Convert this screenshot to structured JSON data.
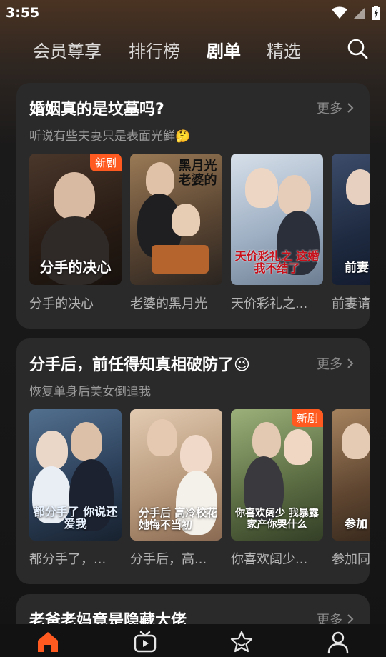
{
  "status_bar": {
    "time": "3:55"
  },
  "top_nav": {
    "tabs": [
      {
        "label": "会员尊享",
        "active": false
      },
      {
        "label": "排行榜",
        "active": false
      },
      {
        "label": "剧单",
        "active": true
      },
      {
        "label": "精选",
        "active": false
      }
    ],
    "search_icon": "search-icon"
  },
  "playlists": [
    {
      "title": "婚姻真的是坟墓吗?",
      "subtitle": "听说有些夫妻只是表面光鲜🤔",
      "more_label": "更多",
      "items": [
        {
          "name": "分手的决心",
          "poster_text": "分手的决心",
          "badge": "新剧",
          "colors": [
            "#3b2b22",
            "#1d1612"
          ]
        },
        {
          "name": "老婆的黑月光",
          "poster_text": "黑月光 老婆的",
          "badge": "",
          "colors": [
            "#7a5a3a",
            "#2b2620"
          ]
        },
        {
          "name": "天价彩礼之...",
          "poster_text": "天价彩礼之 这婚我不结了",
          "badge": "",
          "colors": [
            "#b9c7d6",
            "#6d7f93"
          ]
        },
        {
          "name": "前妻请",
          "poster_text": "前妻 我已",
          "badge": "",
          "colors": [
            "#2e3b55",
            "#121a2a"
          ]
        }
      ]
    },
    {
      "title": "分手后，前任得知真相破防了😉",
      "subtitle": "恢复单身后美女倒追我",
      "more_label": "更多",
      "items": [
        {
          "name": "都分手了，...",
          "poster_text": "都分手了 你说还爱我",
          "badge": "",
          "colors": [
            "#3c5a7a",
            "#1d2b3d"
          ]
        },
        {
          "name": "分手后，高...",
          "poster_text": "分手后 高冷校花 她悔不当初",
          "badge": "",
          "colors": [
            "#c9a98a",
            "#8a6a52"
          ]
        },
        {
          "name": "你喜欢阔少...",
          "poster_text": "你喜欢阔少 我暴露家产你哭什么",
          "badge": "新剧",
          "colors": [
            "#7a8f5a",
            "#3e4a2e"
          ]
        },
        {
          "name": "参加同",
          "poster_text": "参加 我惊",
          "badge": "",
          "colors": [
            "#8a6a4a",
            "#3a2a1e"
          ]
        }
      ]
    },
    {
      "title": "老爸老妈竟是隐藏大佬",
      "subtitle": "",
      "more_label": "更多",
      "items": []
    }
  ],
  "bottom_nav": {
    "items": [
      {
        "icon": "home-icon",
        "active": true,
        "accent": "#ff5a1f"
      },
      {
        "icon": "tv-icon",
        "active": false
      },
      {
        "icon": "star-icon",
        "active": false
      },
      {
        "icon": "profile-icon",
        "active": false
      }
    ]
  },
  "colors": {
    "accent": "#ff5a1f",
    "card_bg": "#2a2a2a",
    "muted_text": "#9a9a9a"
  }
}
